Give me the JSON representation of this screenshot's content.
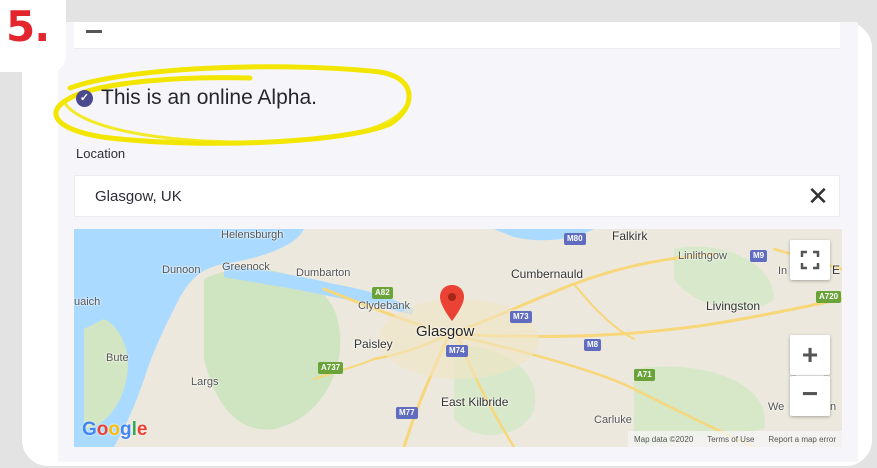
{
  "step": {
    "number": "5."
  },
  "event": {
    "online_note": "This is an online Alpha."
  },
  "location": {
    "label": "Location",
    "value": "Glasgow, UK",
    "clear_symbol": "✕"
  },
  "map": {
    "places": {
      "helensburgh": "Helensburgh",
      "dunoon": "Dunoon",
      "greenock": "Greenock",
      "dumbarton": "Dumbarton",
      "clydebank": "Clydebank",
      "cumbernauld": "Cumbernauld",
      "falkirk": "Falkirk",
      "linlithgow": "Linlithgow",
      "livingston": "Livingston",
      "glasgow": "Glasgow",
      "paisley": "Paisley",
      "bute": "Bute",
      "largs": "Largs",
      "east_kilbride": "East Kilbride",
      "carluke": "Carluke",
      "uaich": "uaich",
      "in_fragment": "In",
      "we_fragment": "We",
      "n_fragment": "n",
      "e_fragment": "E"
    },
    "shields": {
      "m80": "M80",
      "m9": "M9",
      "a82": "A82",
      "m73": "M73",
      "m74": "M74",
      "m8": "M8",
      "a737": "A737",
      "a71": "A71",
      "m77": "M77",
      "a720": "A720"
    },
    "zoom_in_symbol": "+",
    "zoom_out_symbol": "−",
    "attribution": {
      "map_data": "Map data ©2020",
      "terms": "Terms of Use",
      "report": "Report a map error"
    },
    "logo": "Google"
  },
  "colors": {
    "step_red": "#e3262e",
    "check_purple": "#4b4a8f",
    "highlight_yellow": "#f2e600",
    "pin_red": "#ea4335",
    "water": "#aadaff",
    "motorway_shield": "#5f6cc0",
    "a_road_shield": "#6aa33a"
  },
  "icons": {
    "check": "check-circle-icon",
    "clear": "close-icon",
    "fullscreen": "fullscreen-icon",
    "pin": "map-pin-icon"
  }
}
